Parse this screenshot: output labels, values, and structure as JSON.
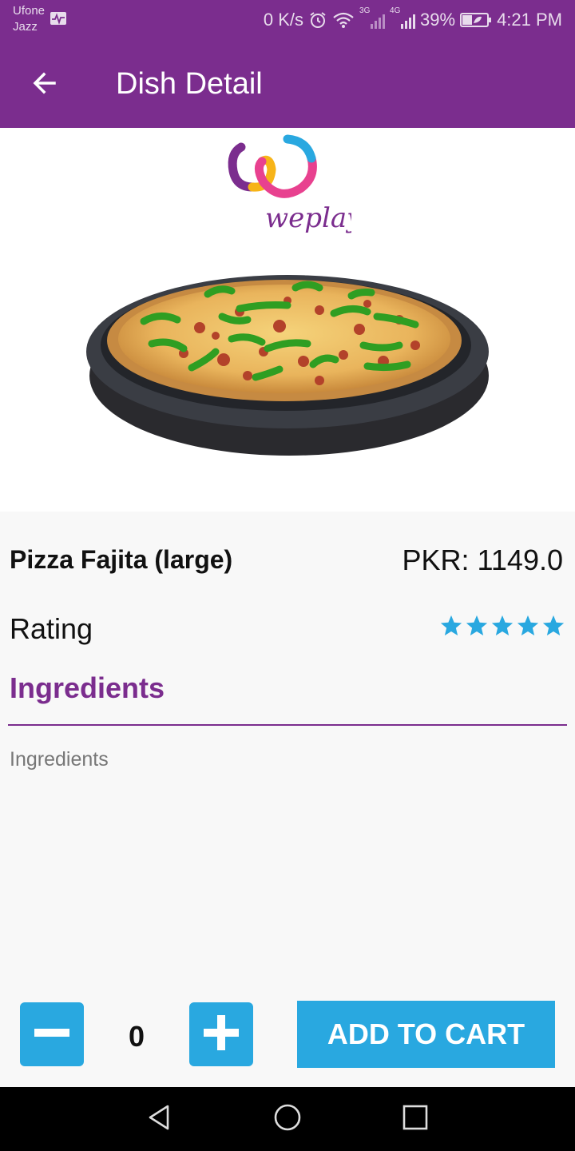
{
  "status_bar": {
    "carrier_line1": "Ufone",
    "carrier_line2": "Jazz",
    "net_speed": "0 K/s",
    "net_3g": "3G",
    "net_4g": "4G",
    "battery": "39%",
    "time": "4:21 PM"
  },
  "app_bar": {
    "title": "Dish Detail",
    "back_icon": "arrow-left-icon"
  },
  "hero": {
    "logo_text": "weplay",
    "image": "pizza-photo"
  },
  "dish": {
    "name": "Pizza Fajita (large)",
    "price": "PKR: 1149.0",
    "rating_label": "Rating",
    "rating_value": 5,
    "rating_max": 5,
    "ingredients_heading": "Ingredients",
    "ingredients_text": "Ingredients"
  },
  "order": {
    "quantity": "0",
    "minus_icon": "minus-icon",
    "plus_icon": "plus-icon",
    "add_to_cart_label": "ADD TO CART"
  },
  "nav_bar": {
    "back": "triangle-back-icon",
    "home": "circle-home-icon",
    "recents": "square-recents-icon"
  },
  "colors": {
    "primary": "#7b2d8e",
    "accent": "#29a8e0",
    "star": "#29a8e0"
  }
}
